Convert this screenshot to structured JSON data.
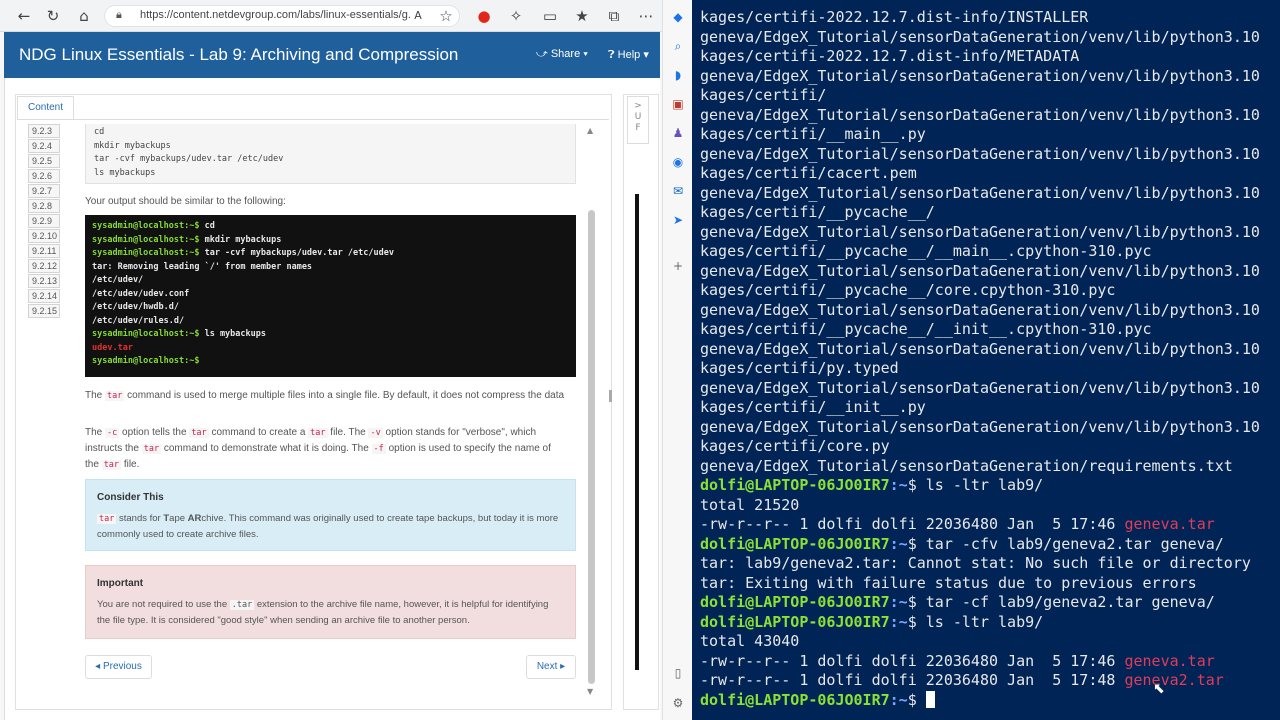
{
  "browser": {
    "url": "https://content.netdevgroup.com/labs/linux-essentials/g...",
    "app_title": "NDG Linux Essentials - Lab 9: Archiving and Compression",
    "share_label": "Share",
    "help_label": "Help",
    "content_tab": "Content",
    "toc": [
      "9.2.3",
      "9.2.4",
      "9.2.5",
      "9.2.6",
      "9.2.7",
      "9.2.8",
      "9.2.9",
      "9.2.10",
      "9.2.11",
      "9.2.12",
      "9.2.13",
      "9.2.14",
      "9.2.15"
    ],
    "commands": [
      "cd",
      "mkdir mybackups",
      "tar -cvf mybackups/udev.tar /etc/udev",
      "ls mybackups"
    ],
    "output_intro": "Your output should be similar to the following:",
    "example_terminal": [
      {
        "prompt": "sysadmin@localhost:~$",
        "text": " cd"
      },
      {
        "prompt": "sysadmin@localhost:~$",
        "text": " mkdir mybackups"
      },
      {
        "prompt": "sysadmin@localhost:~$",
        "text": " tar -cvf mybackups/udev.tar /etc/udev"
      },
      {
        "prompt": "",
        "text": "tar: Removing leading `/' from member names"
      },
      {
        "prompt": "",
        "text": "/etc/udev/"
      },
      {
        "prompt": "",
        "text": "/etc/udev/udev.conf"
      },
      {
        "prompt": "",
        "text": "/etc/udev/hwdb.d/"
      },
      {
        "prompt": "",
        "text": "/etc/udev/rules.d/"
      },
      {
        "prompt": "sysadmin@localhost:~$",
        "text": " ls mybackups"
      },
      {
        "prompt": "",
        "text": "",
        "red": "udev.tar"
      },
      {
        "prompt": "sysadmin@localhost:~$",
        "text": ""
      }
    ],
    "para1": {
      "a": "The ",
      "code1": "tar",
      "b": " command is used to merge multiple files into a single file. By default, it does not compress the data"
    },
    "para2": {
      "a": "The ",
      "code1": "-c",
      "b": " option tells the ",
      "code2": "tar",
      "c": " command to create a ",
      "code3": "tar",
      "d": " file. The ",
      "code4": "-v",
      "e": " option stands for \"verbose\", which instructs the ",
      "code5": "tar",
      "f": " command to demonstrate what it is doing. The ",
      "code6": "-f",
      "g": " option is used to specify the name of the ",
      "code7": "tar",
      "h": " file."
    },
    "consider": {
      "title": "Consider This",
      "code": "tar",
      "text_a": " stands for ",
      "t": "T",
      "text_b": "ape ",
      "ar": "AR",
      "text_c": "chive. This command was originally used to create tape backups, but today it is more commonly used to create archive files."
    },
    "important": {
      "title": "Important",
      "text_a": "You are not required to use the ",
      "code": ".tar",
      "text_b": " extension to the archive file name, however, it is helpful for identifying the file type. It is considered \"good style\" when sending an archive file to another person."
    },
    "prev_label": "Previous",
    "next_label": "Next",
    "right_tab": ">\nU\nF"
  },
  "terminal": {
    "lines": [
      {
        "text": "kages/certifi-2022.12.7.dist-info/INSTALLER"
      },
      {
        "text": "geneva/EdgeX_Tutorial/sensorDataGeneration/venv/lib/python3.10"
      },
      {
        "text": "kages/certifi-2022.12.7.dist-info/METADATA"
      },
      {
        "text": "geneva/EdgeX_Tutorial/sensorDataGeneration/venv/lib/python3.10"
      },
      {
        "text": "kages/certifi/"
      },
      {
        "text": "geneva/EdgeX_Tutorial/sensorDataGeneration/venv/lib/python3.10"
      },
      {
        "text": "kages/certifi/__main__.py"
      },
      {
        "text": "geneva/EdgeX_Tutorial/sensorDataGeneration/venv/lib/python3.10"
      },
      {
        "text": "kages/certifi/cacert.pem"
      },
      {
        "text": "geneva/EdgeX_Tutorial/sensorDataGeneration/venv/lib/python3.10"
      },
      {
        "text": "kages/certifi/__pycache__/"
      },
      {
        "text": "geneva/EdgeX_Tutorial/sensorDataGeneration/venv/lib/python3.10"
      },
      {
        "text": "kages/certifi/__pycache__/__main__.cpython-310.pyc"
      },
      {
        "text": "geneva/EdgeX_Tutorial/sensorDataGeneration/venv/lib/python3.10"
      },
      {
        "text": "kages/certifi/__pycache__/core.cpython-310.pyc"
      },
      {
        "text": "geneva/EdgeX_Tutorial/sensorDataGeneration/venv/lib/python3.10"
      },
      {
        "text": "kages/certifi/__pycache__/__init__.cpython-310.pyc"
      },
      {
        "text": "geneva/EdgeX_Tutorial/sensorDataGeneration/venv/lib/python3.10"
      },
      {
        "text": "kages/certifi/py.typed"
      },
      {
        "text": "geneva/EdgeX_Tutorial/sensorDataGeneration/venv/lib/python3.10"
      },
      {
        "text": "kages/certifi/__init__.py"
      },
      {
        "text": "geneva/EdgeX_Tutorial/sensorDataGeneration/venv/lib/python3.10"
      },
      {
        "text": "kages/certifi/core.py"
      },
      {
        "text": "geneva/EdgeX_Tutorial/sensorDataGeneration/requirements.txt"
      },
      {
        "user": "dolfi@LAPTOP-06JO0IR7",
        "path": ":~",
        "cmd": "$ ls -ltr lab9/"
      },
      {
        "text": "total 21520"
      },
      {
        "text": "-rw-r--r-- 1 dolfi dolfi 22036480 Jan  5 17:46 ",
        "file": "geneva.tar"
      },
      {
        "user": "dolfi@LAPTOP-06JO0IR7",
        "path": ":~",
        "cmd": "$ tar -cfv lab9/geneva2.tar geneva/"
      },
      {
        "text": "tar: lab9/geneva2.tar: Cannot stat: No such file or directory"
      },
      {
        "text": "tar: Exiting with failure status due to previous errors"
      },
      {
        "user": "dolfi@LAPTOP-06JO0IR7",
        "path": ":~",
        "cmd": "$ tar -cf lab9/geneva2.tar geneva/"
      },
      {
        "user": "dolfi@LAPTOP-06JO0IR7",
        "path": ":~",
        "cmd": "$ ls -ltr lab9/"
      },
      {
        "text": "total 43040"
      },
      {
        "text": "-rw-r--r-- 1 dolfi dolfi 22036480 Jan  5 17:46 ",
        "file": "geneva.tar"
      },
      {
        "text": "-rw-r--r-- 1 dolfi dolfi 22036480 Jan  5 17:48 ",
        "file": "geneva2.tar"
      },
      {
        "user": "dolfi@LAPTOP-06JO0IR7",
        "path": ":~",
        "cmd": "$ ",
        "cursor": true
      }
    ]
  }
}
